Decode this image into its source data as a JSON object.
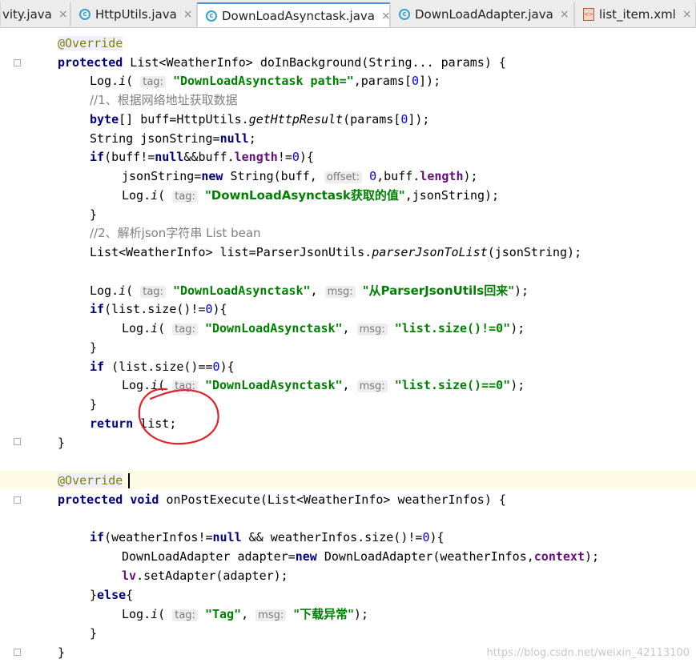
{
  "tabs": [
    {
      "label": "vity.java",
      "icon": "none"
    },
    {
      "label": "HttpUtils.java",
      "icon": "class-icon"
    },
    {
      "label": "DownLoadAsynctask.java",
      "icon": "class-icon",
      "active": true
    },
    {
      "label": "DownLoadAdapter.java",
      "icon": "class-icon"
    },
    {
      "label": "list_item.xml",
      "icon": "xml-icon"
    }
  ],
  "close_glyph": "×",
  "code": {
    "ann1": "@Override",
    "l2_kw": "protected",
    "l2_rest": " List<WeatherInfo> doInBackground(String... params) {",
    "l3_a": "Log.",
    "l3_i": "i",
    "l3_b": "(",
    "hint_tag": "tag:",
    "hint_msg": "msg:",
    "hint_offset": "offset:",
    "l3_str": "\"DownLoadAsynctask path=\"",
    "l3_c": ",params[",
    "zero": "0",
    "l3_d": "]);",
    "c1": "//1、根据网络地址获取数据",
    "l5_kw": "byte",
    "l5_a": "[] buff=HttpUtils.",
    "l5_m": "getHttpResult",
    "l5_b": "(params[",
    "l5_c": "]);",
    "l6_a": "String jsonString=",
    "null": "null",
    "semi": ";",
    "if": "if",
    "l7_a": "(buff!=",
    "l7_b": "&&buff.",
    "length": "length",
    "l7_c": "!=",
    "l7_d": "){",
    "l8_a": "jsonString=",
    "new": "new",
    "l8_b": " String(buff, ",
    "l8_c": ",buff.",
    "l8_d": ");",
    "l9_str": "\"DownLoadAsynctask获取的值\"",
    "l9_b": ",jsonString);",
    "brace_close": "}",
    "c2": "//2、解析json字符串 List bean",
    "l12_a": "List<WeatherInfo> list=ParserJsonUtils.",
    "l12_m": "parserJsonToList",
    "l12_b": "(jsonString);",
    "l14_str1": "\"DownLoadAsynctask\"",
    "l14_str2": "\"从ParserJsonUtils回来\"",
    "close_paren": ");",
    "l15_a": "(list.size()!=",
    "l15_b": "){",
    "l16_str": "\"list.size()!=0\"",
    "l18_a": " (list.size()==",
    "l19_str": "\"list.size()==0\"",
    "return": "return",
    "l21_b": " list;",
    "ann2": "@Override",
    "void": "void",
    "l25_rest": " onPostExecute(List<WeatherInfo> weatherInfos) {",
    "l27_a": "(weatherInfos!=",
    "l27_b": " && weatherInfos.size()!=",
    "l28_a": "DownLoadAdapter adapter=",
    "l28_b": " DownLoadAdapter(weatherInfos,",
    "context": "context",
    "lv": "lv",
    "l29_b": ".setAdapter(adapter);",
    "else_open": "}",
    "else": "else",
    "brace_open": "{",
    "tag_str": "\"Tag\"",
    "err_str": "\"下载异常\"",
    "comma_sp": ", "
  },
  "watermark": "https://blog.csdn.net/weixin_42113100",
  "colors": {
    "keyword": "#000080",
    "string": "#008000",
    "number": "#0000ff",
    "annotation": "#808000",
    "comment": "#808080",
    "annotation_circle": "#e0202a"
  }
}
